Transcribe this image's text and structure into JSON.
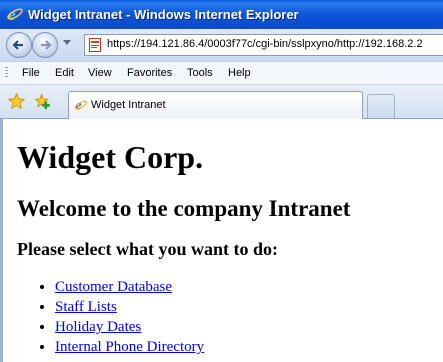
{
  "window": {
    "title": "Widget Intranet - Windows Internet Explorer"
  },
  "address_bar": {
    "url": "https://194.121.86.4/0003f77c/cgi-bin/sslpxyno/http://192.168.2.2"
  },
  "menu": {
    "items": [
      "File",
      "Edit",
      "View",
      "Favorites",
      "Tools",
      "Help"
    ]
  },
  "tabs": [
    {
      "label": "Widget Intranet"
    }
  ],
  "page": {
    "heading": "Widget Corp.",
    "subheading": "Welcome to the company Intranet",
    "prompt": "Please select what you want to do:",
    "links": [
      "Customer Database",
      "Staff Lists",
      "Holiday Dates",
      "Internal Phone Directory"
    ]
  },
  "colors": {
    "titlebar": "#0a4fd0",
    "link": "#0000ee"
  }
}
